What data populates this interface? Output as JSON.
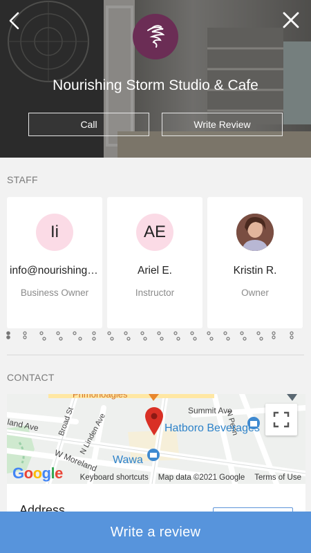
{
  "header": {
    "business_name": "Nourishing Storm Studio & Cafe",
    "call_label": "Call",
    "write_review_label": "Write Review"
  },
  "staff": {
    "title": "STAFF",
    "members": [
      {
        "initials": "Ii",
        "name": "info@nourishingstorm.com",
        "role": "Business Owner"
      },
      {
        "initials": "AE",
        "name": "Ariel E.",
        "role": "Instructor"
      },
      {
        "initials": "",
        "name": "Kristin R.",
        "role": "Owner"
      }
    ]
  },
  "contact": {
    "title": "CONTACT",
    "map": {
      "place_label": "Hatboro Beverages",
      "wawa_label": "Wawa",
      "primo_label": "Primohoagies",
      "streets": [
        "Summit Ave",
        "Broad St",
        "N Linden Ave",
        "W Moreland",
        "land Ave",
        "N Penn"
      ],
      "footer": {
        "shortcuts": "Keyboard shortcuts",
        "map_data": "Map data ©2021 Google",
        "terms": "Terms of Use"
      },
      "logo_text": "Google"
    },
    "address_label": "Address"
  },
  "bottom_bar": {
    "label": "Write a review"
  },
  "colors": {
    "accent": "#5794dc",
    "logo": "#6b2d55",
    "avatar_bg": "#fbdbe6"
  }
}
